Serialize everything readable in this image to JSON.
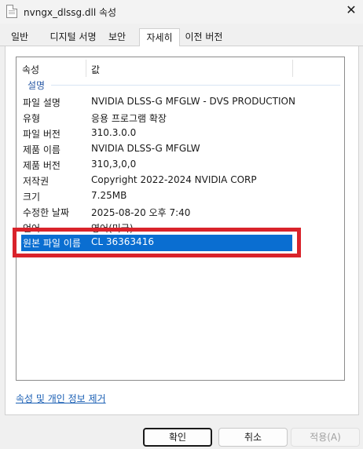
{
  "window": {
    "title": "nvngx_dlssg.dll 속성",
    "close_glyph": "✕"
  },
  "tabs": [
    {
      "label": "일반"
    },
    {
      "label": "디지털 서명"
    },
    {
      "label": "보안"
    },
    {
      "label": "자세히",
      "active": true
    },
    {
      "label": "이전 버전"
    }
  ],
  "details": {
    "column_name": "속성",
    "column_value": "값",
    "group": "설명",
    "rows": [
      {
        "name": "파일 설명",
        "value": "NVIDIA DLSS-G MFGLW - DVS PRODUCTION"
      },
      {
        "name": "유형",
        "value": "응용 프로그램 확장"
      },
      {
        "name": "파일 버전",
        "value": "310.3.0.0"
      },
      {
        "name": "제품 이름",
        "value": "NVIDIA DLSS-G MFGLW"
      },
      {
        "name": "제품 버전",
        "value": "310,3,0,0"
      },
      {
        "name": "저작권",
        "value": "Copyright 2022-2024 NVIDIA CORP"
      },
      {
        "name": "크기",
        "value": "7.25MB"
      },
      {
        "name": "수정한 날짜",
        "value": "2025-08-20 오후 7:40"
      },
      {
        "name": "언어",
        "value": "영어(미국)"
      },
      {
        "name": "원본 파일 이름",
        "value": "CL 36363416",
        "selected": true
      }
    ]
  },
  "remove_link": "속성 및 개인 정보 제거",
  "buttons": {
    "ok": "확인",
    "cancel": "취소",
    "apply": "적용(A)"
  },
  "colors": {
    "selection": "#0a6ed1",
    "highlight_frame": "#d9232b",
    "link": "#1a5fb4"
  }
}
